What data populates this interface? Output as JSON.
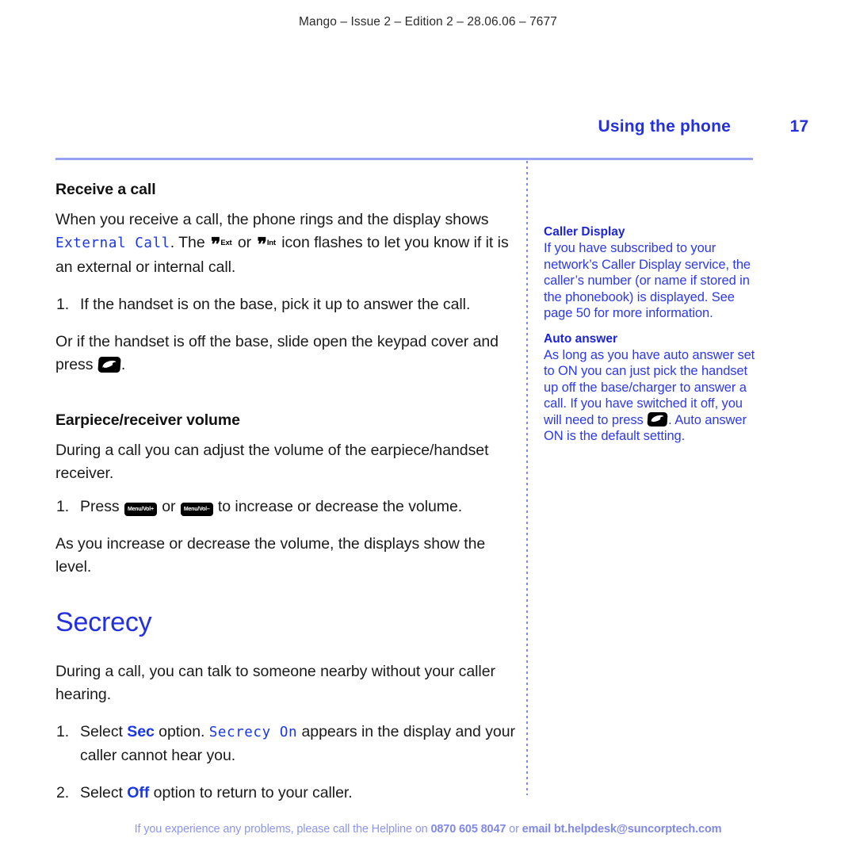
{
  "running_head": "Mango – Issue 2 – Edition 2 – 28.06.06 – 7677",
  "page_header": {
    "chapter": "Using the phone",
    "folio": "17"
  },
  "colors": {
    "heading_blue": "#2430e0",
    "lcd_blue": "#1a37e6",
    "sidebar_blue": "#2e3ae8",
    "rule_periwinkle": "#97a3f2",
    "footer_blue": "#8d96ea",
    "body_black": "#1a1a1a"
  },
  "main": {
    "receive_a_call": {
      "heading": "Receive a call",
      "intro_part1": "When you receive a call, the phone rings and the display shows ",
      "intro_lcd": "External Call",
      "intro_part2": ". The ",
      "icon_ext_tag": "Ext",
      "intro_part3": " or ",
      "icon_int_tag": "Int",
      "intro_part4": " icon flashes to let you know if it is an external or internal call.",
      "step1_num": "1.",
      "step1_text": "If the handset is on the base, pick it up to answer the call.",
      "step1_cont_part1": "Or if the handset is off the base, slide open the keypad cover and press ",
      "step1_cont_part2": "."
    },
    "earpiece_volume": {
      "heading": "Earpiece/receiver volume",
      "intro": "During a call you can adjust the volume of the earpiece/handset receiver.",
      "step1_num": "1.",
      "step1_part1": "Press ",
      "key_vol_up": "Menu/Vol+",
      "step1_part2": " or ",
      "key_vol_down": "Menu/Vol–",
      "step1_part3": " to increase or decrease the volume.",
      "step1_cont": "As you increase or decrease the volume, the displays show the level."
    },
    "secrecy": {
      "heading": "Secrecy",
      "intro": "During a call, you can talk to someone nearby without your caller hearing.",
      "step1_num": "1.",
      "step1_part1": "Select ",
      "step1_softkey": "Sec",
      "step1_part2": " option. ",
      "step1_lcd": "Secrecy On",
      "step1_part3": " appears in the display and your caller cannot hear you.",
      "step2_num": "2.",
      "step2_part1": "Select ",
      "step2_softkey": "Off",
      "step2_part2": " option to return to your caller."
    }
  },
  "sidebar": {
    "caller_display": {
      "heading": "Caller Display",
      "body": "If you have subscribed to your network’s Caller Display service, the caller’s number (or name if stored in the phonebook) is displayed. See page 50 for more information."
    },
    "auto_answer": {
      "heading": "Auto answer",
      "body_part1": "As long as you have auto answer set to ON you can just pick the handset up off the base/charger to answer a call. If you have switched it off, you will need to press ",
      "body_part2": ". Auto answer ON is the default setting."
    }
  },
  "footer": {
    "part1": "If you experience any problems, please call the Helpline on ",
    "phone": "0870 605 8047",
    "part2": " or ",
    "email": "email bt.helpdesk@suncorptech.com"
  }
}
